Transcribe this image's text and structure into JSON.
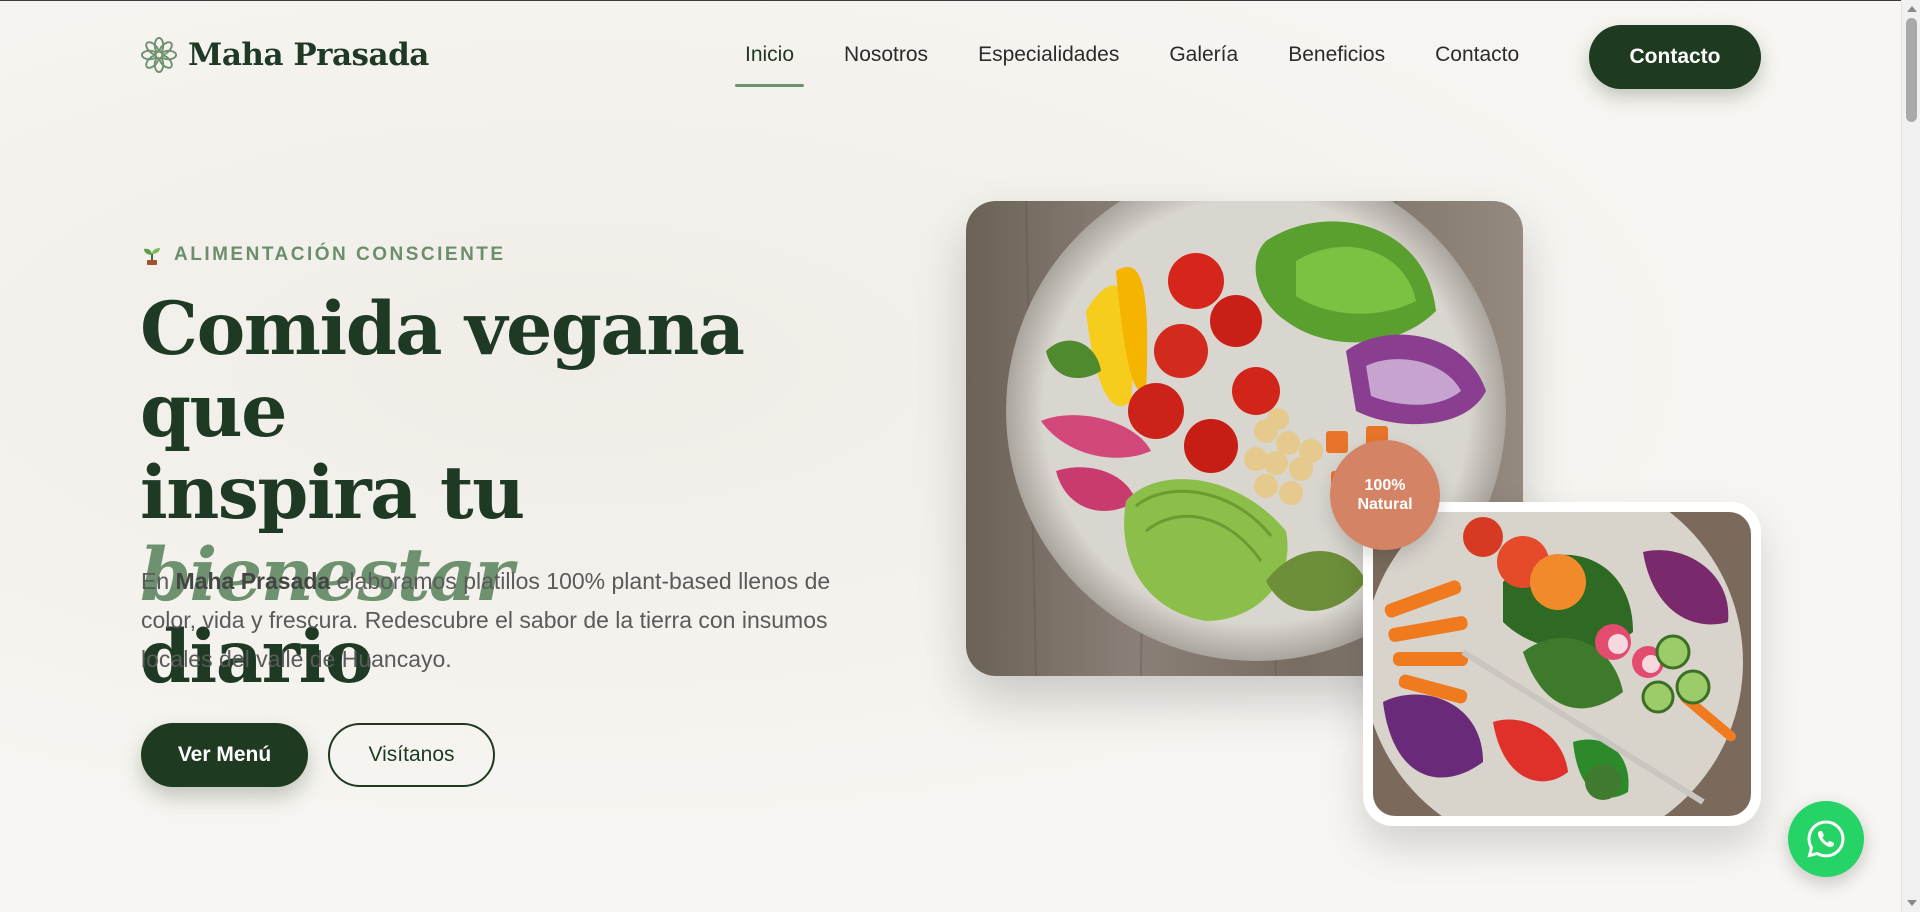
{
  "brand": {
    "name": "Maha Prasada",
    "logo_icon": "lotus-flower-icon"
  },
  "nav": {
    "links": [
      {
        "label": "Inicio",
        "active": true
      },
      {
        "label": "Nosotros",
        "active": false
      },
      {
        "label": "Especialidades",
        "active": false
      },
      {
        "label": "Galería",
        "active": false
      },
      {
        "label": "Beneficios",
        "active": false
      },
      {
        "label": "Contacto",
        "active": false
      }
    ],
    "cta_label": "Contacto"
  },
  "hero": {
    "eyebrow_icon": "sprout-icon",
    "eyebrow": "ALIMENTACIÓN CONSCIENTE",
    "title_line1": "Comida vegana que",
    "title_line2_start": "inspira tu ",
    "title_accent": "bienestar",
    "title_line3": "diario",
    "desc_prefix": "En ",
    "desc_brand": "Maha Prasada",
    "desc_rest": " elaboramos platillos 100% plant-based llenos de color, vida y frescura. Redescubre el sabor de la tierra con insumos locales del valle de Huancayo.",
    "primary_button": "Ver Menú",
    "secondary_button": "Visítanos"
  },
  "badge": {
    "line1": "100%",
    "line2": "Natural"
  },
  "images": {
    "main": "vegan-bowl-photo",
    "secondary": "salad-plate-photo"
  },
  "floating": {
    "whatsapp_icon": "whatsapp-icon"
  },
  "colors": {
    "primary": "#1e3a20",
    "accent": "#6e9270",
    "badge": "#d48465",
    "whatsapp": "#25d366",
    "background": "#f5f3ef"
  }
}
